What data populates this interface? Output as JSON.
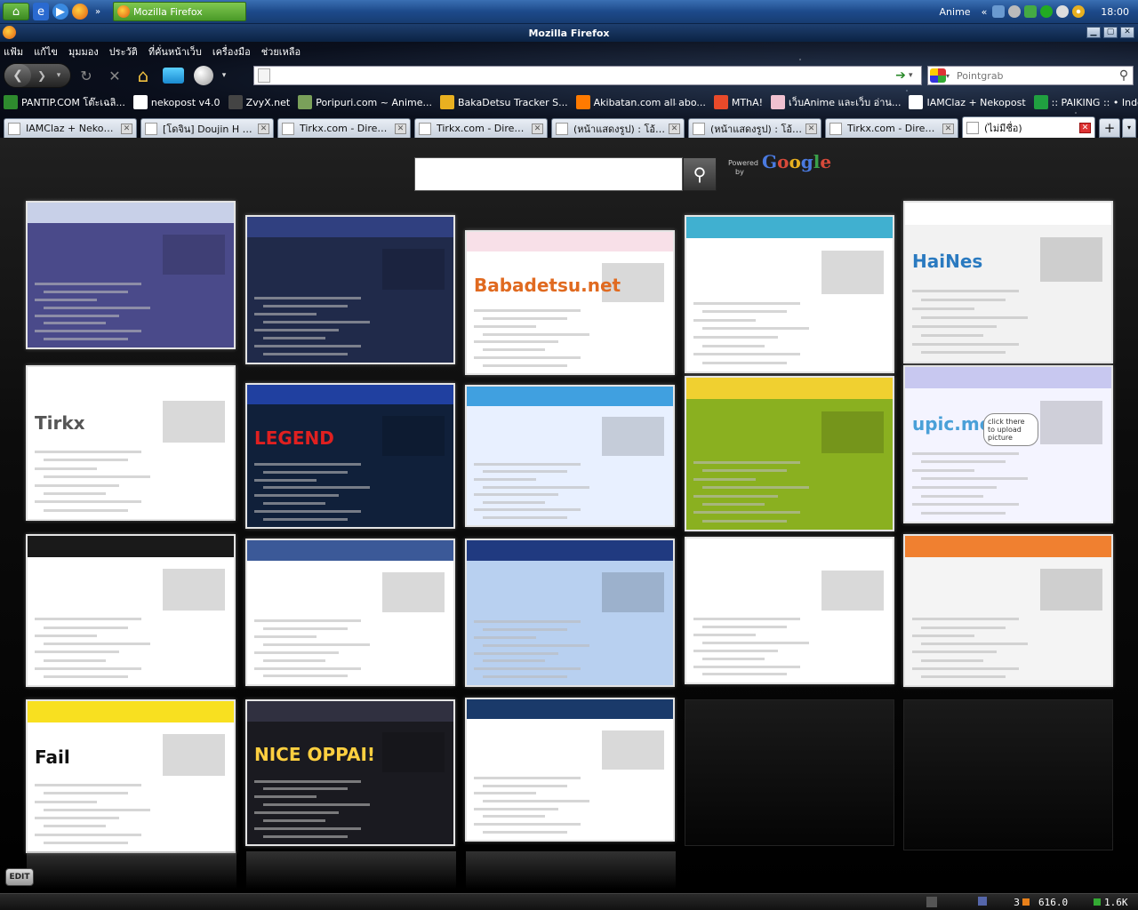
{
  "taskbar": {
    "task_label": "Mozilla Firefox",
    "user": "Anime",
    "arrows": "«",
    "clock": "18:00"
  },
  "window": {
    "title": "Mozilla Firefox",
    "minimize": "▁",
    "maximize": "▢",
    "close": "✕"
  },
  "menu": [
    "แฟ้ม",
    "แก้ไข",
    "มุมมอง",
    "ประวัติ",
    "ที่คั่นหน้าเว็บ",
    "เครื่องมือ",
    "ช่วยเหลือ"
  ],
  "nav": {
    "url_value": "",
    "search_engine": "Pointgrab"
  },
  "bookmarks": [
    {
      "label": "PANTIP.COM โต๊ะเฉลิ...",
      "color": "#2e8b2e"
    },
    {
      "label": "nekopost v4.0",
      "color": "#ffffff"
    },
    {
      "label": "ZvyX.net",
      "color": "#444444"
    },
    {
      "label": "Poripuri.com ~ Anime...",
      "color": "#7aa05a"
    },
    {
      "label": "BakaDetsu Tracker S...",
      "color": "#e8b020"
    },
    {
      "label": "Akibatan.com all abo...",
      "color": "#ff7a00"
    },
    {
      "label": "MThA!",
      "color": "#e84a2a"
    },
    {
      "label": "เว็บAnime และเว็บ อ่าน...",
      "color": "#f0c0d0"
    },
    {
      "label": "IAMClaz + Nekopost",
      "color": "#ffffff"
    },
    {
      "label": ":: PAIKING :: • Index ...",
      "color": "#20a040"
    }
  ],
  "tabs": [
    {
      "label": "IAMClaz + Nekopost",
      "active": false
    },
    {
      "label": "[โดจิน] Doujin H แ...",
      "active": false
    },
    {
      "label": "Tirkx.com - Direct...",
      "active": false
    },
    {
      "label": "Tirkx.com - Direct...",
      "active": false
    },
    {
      "label": "(หน้าแสดงรูป) : โอ้โ...",
      "active": false
    },
    {
      "label": "(หน้าแสดงรูป) : โอ้โ...",
      "active": false
    },
    {
      "label": "Tirkx.com - Direct...",
      "active": false
    },
    {
      "label": "(ไม่มีชื่อ)",
      "active": true
    }
  ],
  "tab_close": "✕",
  "new_tab": "+",
  "speed_dial": {
    "search_value": "",
    "powered_by_1": "Powered",
    "powered_by_2": "by",
    "google": "Google",
    "edit": "EDIT",
    "tile_titles": {
      "babadetsu": "Babadetsu.net",
      "haines": "HaiNes",
      "tirkx": "Tirkx",
      "upic": "upic.me",
      "upic_bubble": "click there to upload picture",
      "legend": "LEGEND",
      "fail": "Fail",
      "nice": "NICE OPPAI!"
    }
  },
  "status": {
    "count": "3",
    "speed": "616.0",
    "size": "1.6K"
  }
}
